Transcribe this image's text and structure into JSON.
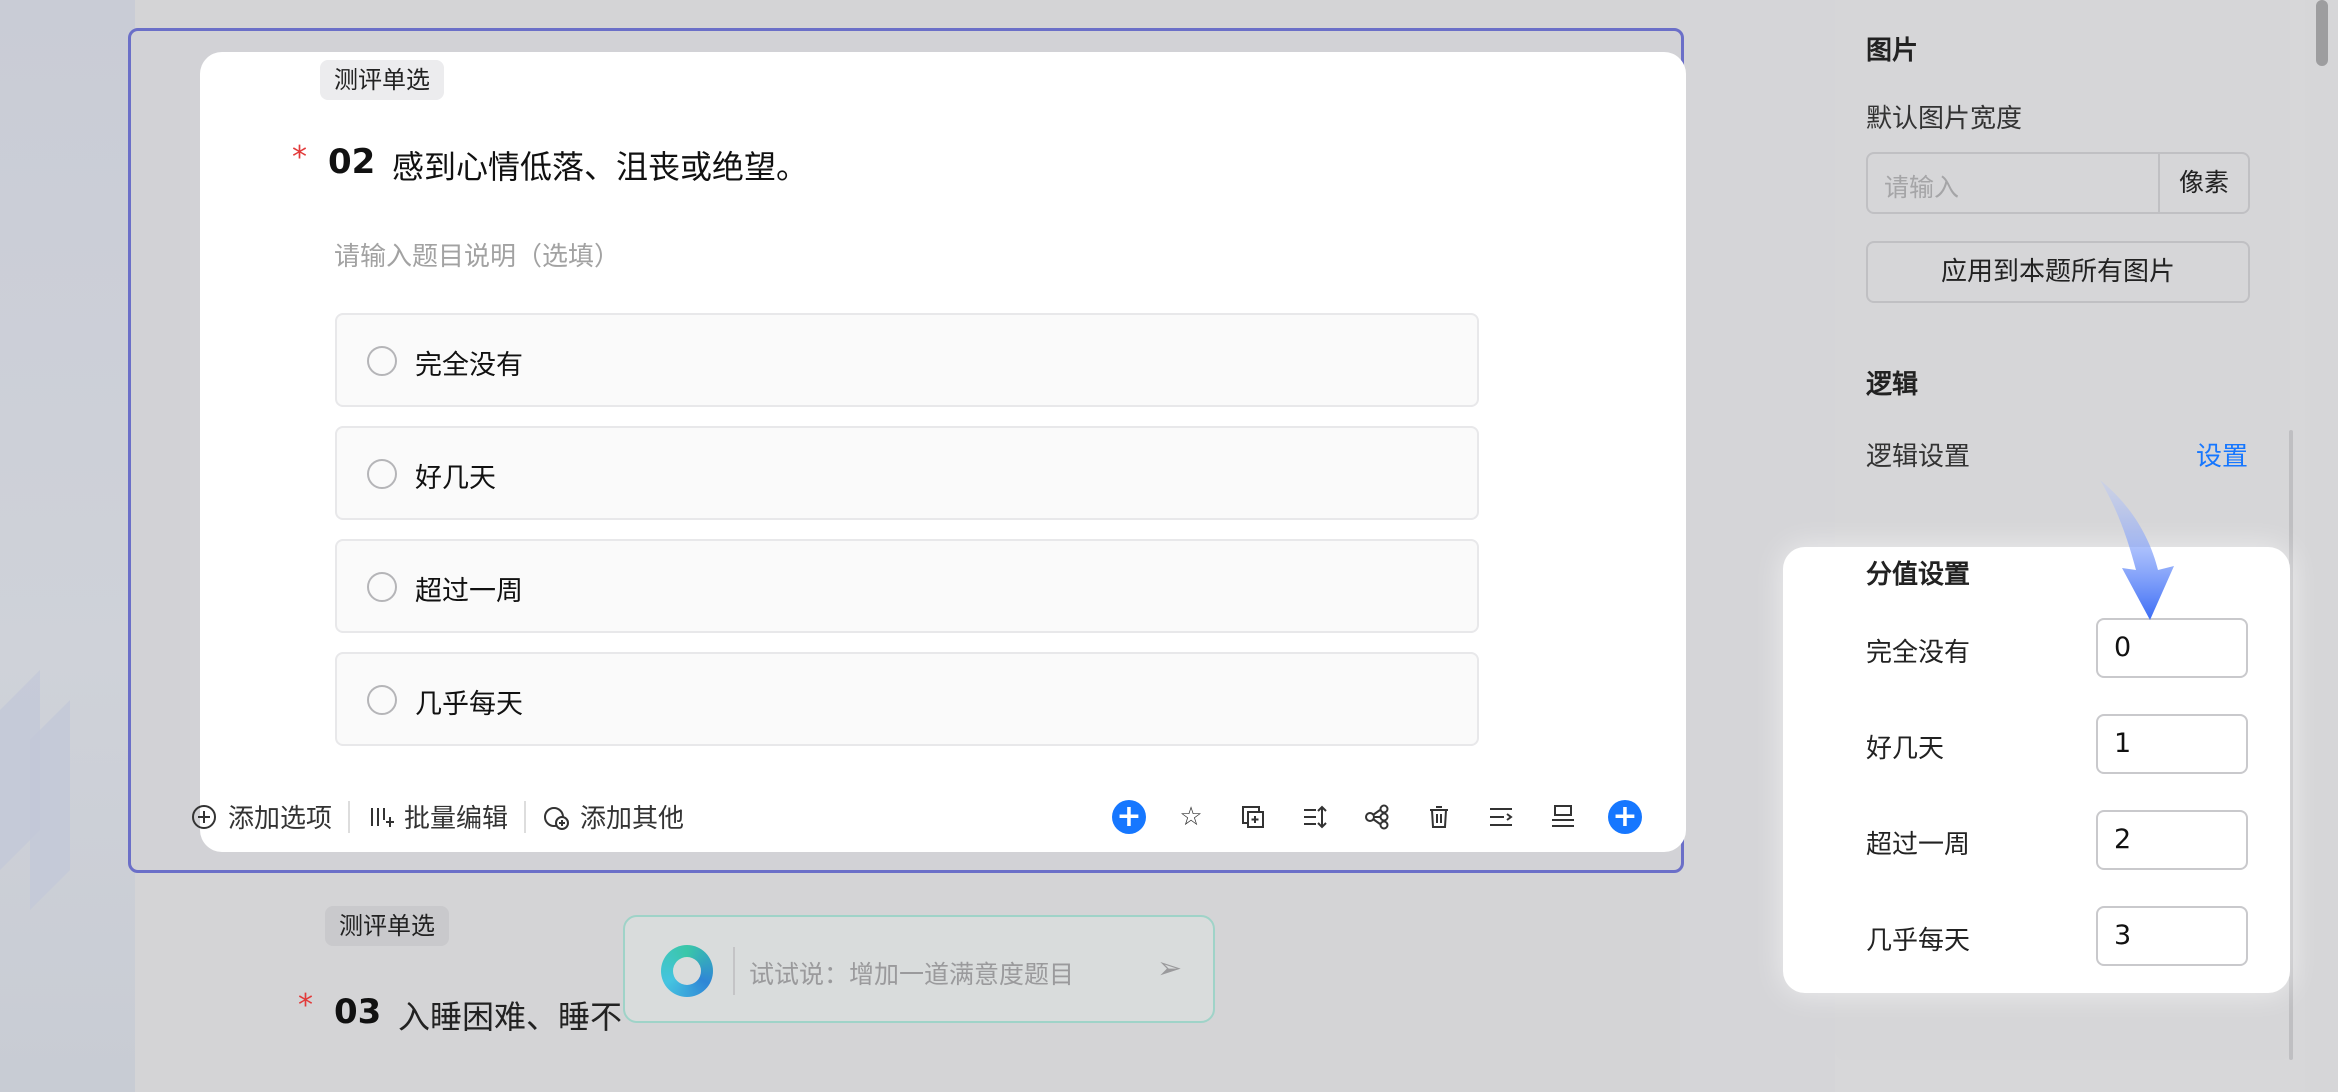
{
  "question": {
    "tag": "测评单选",
    "required_mark": "*",
    "number": "02",
    "title": "感到心情低落、沮丧或绝望。",
    "description_placeholder": "请输入题目说明（选填）",
    "options": [
      "完全没有",
      "好几天",
      "超过一周",
      "几乎每天"
    ]
  },
  "toolbar": {
    "add_option": "添加选项",
    "batch_edit": "批量编辑",
    "add_other": "添加其他",
    "icons": [
      "add-circle-icon",
      "star-icon",
      "copy-icon",
      "sort-icon",
      "logic-branch-icon",
      "trash-icon",
      "indent-icon",
      "layout-icon",
      "add-circle-icon"
    ]
  },
  "next_question": {
    "tag": "测评单选",
    "required_mark": "*",
    "number": "03",
    "title_visible": "入睡困难、睡不"
  },
  "ai_bar": {
    "placeholder": "试试说：增加一道满意度题目"
  },
  "right_panel": {
    "image_section": "图片",
    "default_width_label": "默认图片宽度",
    "width_placeholder": "请输入",
    "width_unit": "像素",
    "apply_all": "应用到本题所有图片",
    "logic_section": "逻辑",
    "logic_setting_label": "逻辑设置",
    "logic_setting_link": "设置"
  },
  "score_settings": {
    "title": "分值设置",
    "rows": [
      {
        "label": "完全没有",
        "value": "0"
      },
      {
        "label": "好几天",
        "value": "1"
      },
      {
        "label": "超过一周",
        "value": "2"
      },
      {
        "label": "几乎每天",
        "value": "3"
      }
    ]
  },
  "colors": {
    "accent": "#1677ff",
    "frame": "#6b6fc8",
    "required": "#e23a3a"
  }
}
